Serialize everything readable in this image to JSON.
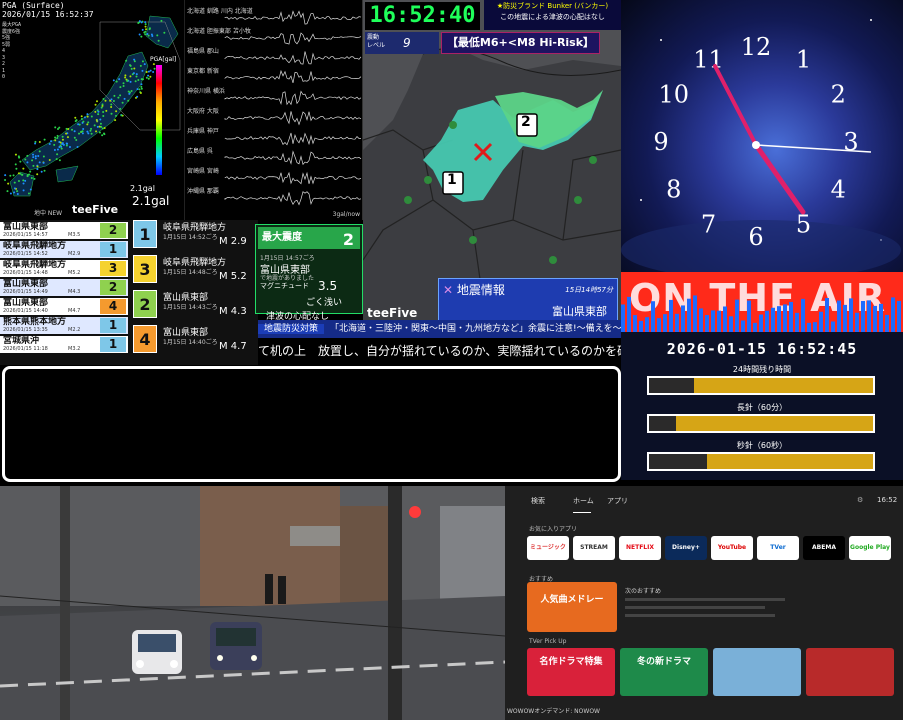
{
  "map_panel": {
    "header_title": "PGA (Surface)",
    "header_time": "2026/01/15 16:52:37",
    "legend_lines": [
      "最大PGA",
      "震度6強",
      "5強",
      "5弱",
      "4",
      "3",
      "2",
      "1",
      "0"
    ],
    "pga_label": "PGA[gal]",
    "gal_small": "2.1gal",
    "gal_big": "2.1gal",
    "footer_left": "地中 NEW",
    "brand": "teeFive"
  },
  "wave_panel": {
    "stations": [
      "北海道 釧路 川内 北海道",
      "北海道 胆振東部 苫小牧",
      "福島県 郡山",
      "東京都 新宿",
      "神奈川県 横浜",
      "大阪府 大阪",
      "兵庫県 神戸",
      "広島県 呉",
      "宮崎県 宮崎",
      "沖縄県 那覇"
    ],
    "footer": "3gal/now"
  },
  "quake_panel": {
    "clock": "16:52:40",
    "bunker_title": "★防災ブランド Bunker (バンカー)",
    "bunker_sub": "この地震による津波の心配はなし",
    "level_label": "震動\nレベル",
    "level_value": "9",
    "risk_text": "【最低M6+<M8 Hi-Risk】",
    "region_1": "1",
    "region_2": "2",
    "info_title": "地震情報",
    "info_date": "15日14時57分",
    "info_region": "富山県東部",
    "brand": "teeFive"
  },
  "clock_panel": {
    "numerals": [
      "12",
      "1",
      "2",
      "3",
      "4",
      "5",
      "6",
      "7",
      "8",
      "9",
      "10",
      "11"
    ]
  },
  "air_panel": {
    "banner": "ON THE AIR",
    "datetime": "2026-01-15 16:52:45",
    "bars": [
      {
        "label": "24時間残り時間",
        "fill": 0.2
      },
      {
        "label": "長針（60分）",
        "fill": 0.12
      },
      {
        "label": "秒針（60秒）",
        "fill": 0.26
      }
    ]
  },
  "quake_list": [
    {
      "place": "富山県東部",
      "time": "2026/01/15 14:57",
      "mag": "M3.5",
      "intensity": "2",
      "color": "#8fd14f"
    },
    {
      "place": "岐阜県飛騨地方",
      "time": "2026/01/15 14:52",
      "mag": "M2.9",
      "intensity": "1",
      "color": "#7ec7e8"
    },
    {
      "place": "岐阜県飛騨地方",
      "time": "2026/01/15 14:48",
      "mag": "M5.2",
      "intensity": "3",
      "color": "#f5d22e"
    },
    {
      "place": "富山県東部",
      "time": "2026/01/15 14:49",
      "mag": "M4.3",
      "intensity": "2",
      "color": "#8fd14f"
    },
    {
      "place": "富山県東部",
      "time": "2026/01/15 14:40",
      "mag": "M4.7",
      "intensity": "4",
      "color": "#f59a2e"
    },
    {
      "place": "熊本県熊本地方",
      "time": "2026/01/15 13:35",
      "mag": "M2.2",
      "intensity": "1",
      "color": "#7ec7e8"
    },
    {
      "place": "宮城県沖",
      "time": "2026/01/15 11:18",
      "mag": "M3.2",
      "intensity": "1",
      "color": "#7ec7e8"
    }
  ],
  "quake_detail": [
    {
      "badge": "1",
      "color": "#7ec7e8",
      "place": "岐阜県飛騨地方",
      "meta": "1月15日 14:52ごろ",
      "mag": "M 2.9"
    },
    {
      "badge": "3",
      "color": "#f5d22e",
      "place": "岐阜県飛騨地方",
      "meta": "1月15日 14:48ごろ",
      "mag": "M 5.2"
    },
    {
      "badge": "2",
      "color": "#8fd14f",
      "place": "富山県東部",
      "meta": "1月15日 14:43ごろ",
      "mag": "M 4.3"
    },
    {
      "badge": "4",
      "color": "#f59a2e",
      "place": "富山県東部",
      "meta": "1月15日 14:40ごろ",
      "mag": "M 4.7"
    }
  ],
  "max_intensity": {
    "label": "最大震度",
    "value": "2",
    "sub1": "1月15日 14:57ごろ",
    "place": "富山県東部",
    "sub2": "で地震がありました",
    "mag_label": "マグニチュード",
    "mag_value": "3.5",
    "depth": "ごく浅い",
    "tsunami": "津波の心配なし"
  },
  "ticker": {
    "tag": "地震防災対策",
    "line1": "「北海道・三陸沖・関東〜中国・九州地方など」余震に注意!〜備えを〜",
    "line2": "て机の上　放置し、自分が揺れているのか、実際揺れているのかを確認"
  },
  "tv_panel": {
    "nav": [
      "検索",
      "ホーム",
      "アプリ"
    ],
    "time": "16:52",
    "fav_label": "お気に入りアプリ",
    "apps": [
      "ミュージック",
      "STREAM",
      "NETFLIX",
      "Disney+",
      "YouTube",
      "TVer",
      "ABEMA",
      "Google Play"
    ],
    "row2_label": "おすすめ",
    "tile_main": "人気曲メドレー",
    "row2_desc": "次のおすすめ",
    "row3_label": "TVer Pick Up",
    "tiles": [
      "名作ドラマ特集",
      "冬の新ドラマ",
      "",
      ""
    ],
    "footer": "WOWOWオンデマンド: NOWOW"
  }
}
